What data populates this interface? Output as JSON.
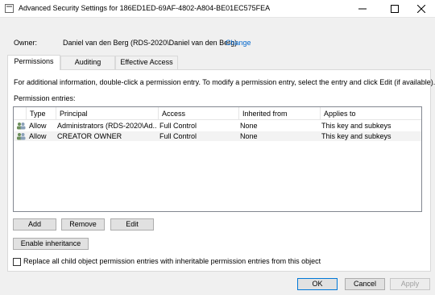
{
  "window": {
    "title": "Advanced Security Settings for 186ED1ED-69AF-4802-A804-BE01EC575FEA"
  },
  "owner": {
    "label": "Owner:",
    "value": "Daniel van den Berg (RDS-2020\\Daniel van den Berg)",
    "change_link": "Change"
  },
  "tabs": [
    {
      "label": "Permissions",
      "active": true
    },
    {
      "label": "Auditing",
      "active": false
    },
    {
      "label": "Effective Access",
      "active": false
    }
  ],
  "info_text": "For additional information, double-click a permission entry. To modify a permission entry, select the entry and click Edit (if available).",
  "entries_label": "Permission entries:",
  "table": {
    "columns": [
      "Type",
      "Principal",
      "Access",
      "Inherited from",
      "Applies to"
    ],
    "rows": [
      {
        "type": "Allow",
        "principal": "Administrators (RDS-2020\\Ad...",
        "access": "Full Control",
        "inherited": "None",
        "applies": "This key and subkeys"
      },
      {
        "type": "Allow",
        "principal": "CREATOR OWNER",
        "access": "Full Control",
        "inherited": "None",
        "applies": "This key and subkeys"
      }
    ]
  },
  "buttons": {
    "add": "Add",
    "remove": "Remove",
    "edit": "Edit",
    "enable_inheritance": "Enable inheritance",
    "ok": "OK",
    "cancel": "Cancel",
    "apply": "Apply"
  },
  "checkbox": {
    "label": "Replace all child object permission entries with inheritable permission entries from this object",
    "checked": false
  },
  "icons": {
    "title": "shield-icon",
    "user": "user-group-icon"
  },
  "colors": {
    "link": "#0066cc",
    "default_button_border": "#0078d7"
  }
}
